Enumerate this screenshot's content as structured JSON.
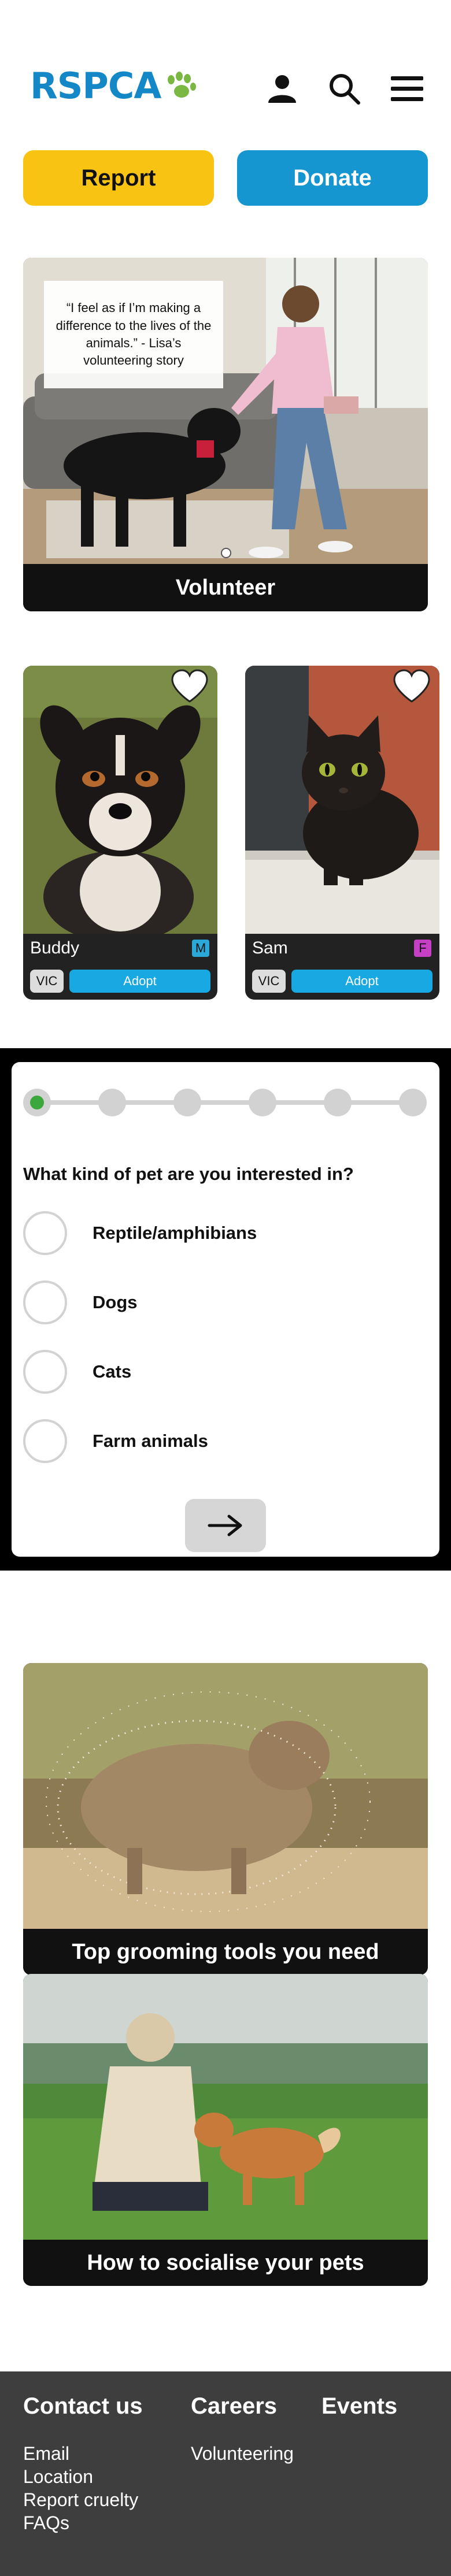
{
  "header": {
    "logo_text": "RSPCA",
    "icons": [
      "paw-icon",
      "user-icon",
      "search-icon",
      "menu-icon"
    ]
  },
  "actions": {
    "report_label": "Report",
    "donate_label": "Donate"
  },
  "hero": {
    "quote": "“I feel as if I’m making a difference to the lives of the animals.” - Lisa’s volunteering story",
    "label": "Volunteer"
  },
  "pets": [
    {
      "name": "Buddy",
      "gender": "M",
      "gender_color": "#2ba8d8",
      "state": "VIC",
      "adopt_label": "Adopt"
    },
    {
      "name": "Sam",
      "gender": "F",
      "gender_color": "#c640c6",
      "state": "VIC",
      "adopt_label": "Adopt"
    }
  ],
  "quiz": {
    "question": "What kind of pet are you interested in?",
    "progress": {
      "current_step": 1,
      "total_steps": 6
    },
    "options": [
      "Reptile/amphibians",
      "Dogs",
      "Cats",
      "Farm animals"
    ],
    "next_icon": "arrow-right-icon"
  },
  "articles": [
    {
      "label": "Top grooming tools you need"
    },
    {
      "label": "How to socialise your pets"
    }
  ],
  "footer": {
    "contact_heading": "Contact us",
    "contact_links": [
      "Email",
      "Location",
      "Report cruelty",
      "FAQs"
    ],
    "careers_heading": "Careers",
    "careers_links": [
      "Volunteering"
    ],
    "events_heading": "Events"
  },
  "colors": {
    "brand_blue": "#1487c6",
    "paw_green": "#7ab743",
    "report_yellow": "#f8c313",
    "donate_blue": "#1696d0",
    "adopt_blue": "#18a8e2",
    "quiz_active_green": "#3ca83c",
    "footer_grey": "#3e3e3e"
  }
}
